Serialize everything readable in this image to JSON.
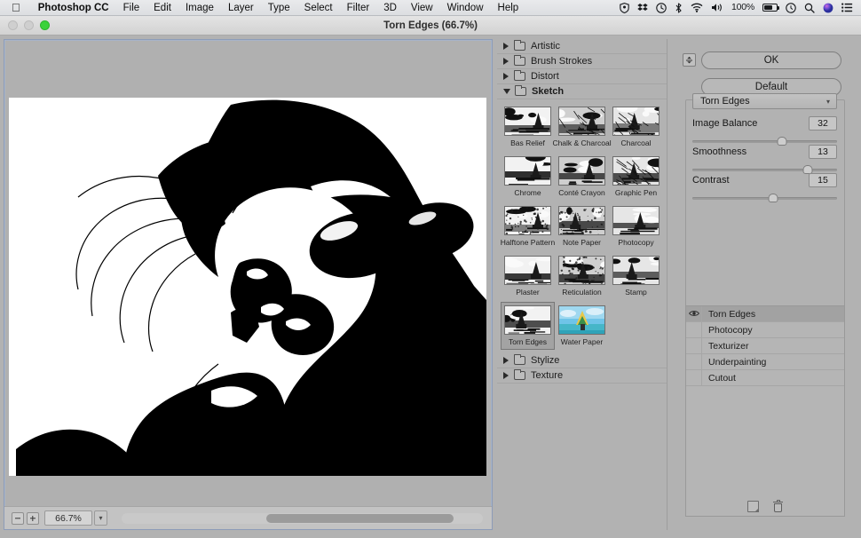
{
  "menubar": {
    "apple_icon": "apple-logo",
    "items": [
      "Photoshop CC",
      "File",
      "Edit",
      "Image",
      "Layer",
      "Type",
      "Select",
      "Filter",
      "3D",
      "View",
      "Window",
      "Help"
    ],
    "status": {
      "icons": [
        "shield-icon",
        "dropbox-icon",
        "time-machine-icon",
        "bluetooth-icon",
        "wifi-icon",
        "volume-icon"
      ],
      "battery_percent": "100%",
      "battery_icon": "battery-charging-icon",
      "clock_icon": "clock-icon",
      "search_icon": "spotlight-search-icon",
      "siri_icon": "siri-icon",
      "notification_icon": "notification-center-icon"
    }
  },
  "window": {
    "title": "Torn Edges (66.7%)",
    "traffic": {
      "close": "close-button",
      "minimize": "minimize-button",
      "zoom": "zoom-button"
    }
  },
  "preview": {
    "zoom_out_icon": "zoom-out-icon",
    "zoom_in_icon": "zoom-in-icon",
    "zoom_level": "66.7%",
    "zoom_caret": "▾",
    "image_alt": "high-contrast black and white portrait of a woman wearing sunglasses"
  },
  "filters": {
    "categories": [
      {
        "name": "Artistic",
        "open": false
      },
      {
        "name": "Brush Strokes",
        "open": false
      },
      {
        "name": "Distort",
        "open": false
      },
      {
        "name": "Sketch",
        "open": true
      }
    ],
    "sketch_filters": [
      {
        "label": "Bas Relief",
        "selected": false
      },
      {
        "label": "Chalk & Charcoal",
        "selected": false
      },
      {
        "label": "Charcoal",
        "selected": false
      },
      {
        "label": "Chrome",
        "selected": false
      },
      {
        "label": "Conté Crayon",
        "selected": false
      },
      {
        "label": "Graphic Pen",
        "selected": false
      },
      {
        "label": "Halftone Pattern",
        "selected": false
      },
      {
        "label": "Note Paper",
        "selected": false
      },
      {
        "label": "Photocopy",
        "selected": false
      },
      {
        "label": "Plaster",
        "selected": false
      },
      {
        "label": "Reticulation",
        "selected": false
      },
      {
        "label": "Stamp",
        "selected": false
      },
      {
        "label": "Torn Edges",
        "selected": true
      },
      {
        "label": "Water Paper",
        "selected": false
      }
    ],
    "trailing_categories": [
      {
        "name": "Stylize",
        "open": false
      },
      {
        "name": "Texture",
        "open": false
      }
    ]
  },
  "controls": {
    "collapse_icon": "collapse-panel-icon",
    "ok_label": "OK",
    "default_label": "Default",
    "filter_select": {
      "value": "Torn Edges",
      "caret": "▾"
    },
    "sliders": [
      {
        "label": "Image Balance",
        "value": "32",
        "percent": 62
      },
      {
        "label": "Smoothness",
        "value": "13",
        "percent": 80
      },
      {
        "label": "Contrast",
        "value": "15",
        "percent": 56
      }
    ]
  },
  "effects": {
    "rows": [
      {
        "label": "Torn Edges",
        "visible": true,
        "selected": true
      },
      {
        "label": "Photocopy",
        "visible": false,
        "selected": false
      },
      {
        "label": "Texturizer",
        "visible": false,
        "selected": false
      },
      {
        "label": "Underpainting",
        "visible": false,
        "selected": false
      },
      {
        "label": "Cutout",
        "visible": false,
        "selected": false
      }
    ],
    "eye_icon": "eye-visibility-icon",
    "new_effect_icon": "new-effect-layer-icon",
    "delete_icon": "trash-delete-icon"
  },
  "colors": {
    "panel_bg": "#b2b2b2",
    "menubar_bg": "#e2e4e7",
    "selection": "#a2a2a2",
    "window_border": "#8d9cb8"
  }
}
